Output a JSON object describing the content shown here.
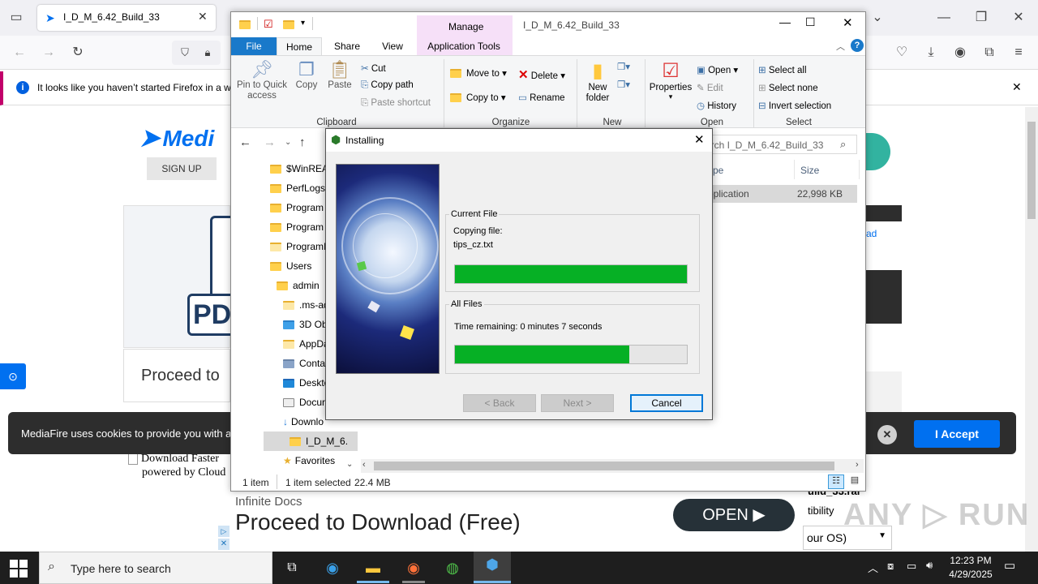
{
  "browser": {
    "tab_title": "I_D_M_6.42_Build_33",
    "notification": "It looks like you haven’t started Firefox in a wh",
    "signup": "SIGN UP",
    "logo": "Medi",
    "proceed_partial": "Proceed to",
    "download_faster": "Download Faster",
    "powered_by": "powered by Cloud",
    "cookie_text": "MediaFire uses cookies to provide you with a",
    "accept": "I Accept",
    "right_link": "ad",
    "right_file": "uild_33.rar",
    "right_compat": "tibility",
    "right_os": "our OS)",
    "ad_brand": "Infinite Docs",
    "ad_title": "Proceed to Download (Free)",
    "ad_open": "OPEN",
    "ad_doc_text": "PD",
    "watermark": "ANY RUN"
  },
  "explorer": {
    "title": "I_D_M_6.42_Build_33",
    "manage": "Manage",
    "tabs": [
      "File",
      "Home",
      "Share",
      "View",
      "Application Tools"
    ],
    "clipboard": {
      "pin": "Pin to Quick access",
      "copy": "Copy",
      "paste": "Paste",
      "cut": "Cut",
      "copy_path": "Copy path",
      "paste_shortcut": "Paste shortcut",
      "label": "Clipboard"
    },
    "organize": {
      "move_to": "Move to",
      "copy_to": "Copy to",
      "delete": "Delete",
      "rename": "Rename",
      "label": "Organize"
    },
    "new": {
      "new_folder": "New folder",
      "label": "New"
    },
    "open": {
      "properties": "Properties",
      "open": "Open",
      "edit": "Edit",
      "history": "History",
      "label": "Open"
    },
    "select": {
      "select_all": "Select all",
      "select_none": "Select none",
      "invert": "Invert selection",
      "label": "Select"
    },
    "search_placeholder": "arch I_D_M_6.42_Build_33",
    "columns": {
      "type": "ype",
      "size": "Size"
    },
    "file_row": {
      "type": "pplication",
      "size": "22,998 KB"
    },
    "tree": [
      "$WinREA",
      "PerfLogs",
      "Program",
      "Program",
      "ProgramI",
      "Users",
      "admin",
      ".ms-ad",
      "3D Ob",
      "AppDa",
      "Conta",
      "Deskto",
      "Docur",
      "Downlo",
      "I_D_M_6.",
      "Favorites"
    ],
    "status": {
      "count": "1 item",
      "selected": "1 item selected",
      "size": "22.4 MB"
    }
  },
  "installer": {
    "title": "Installing",
    "current_file_label": "Current File",
    "copying": "Copying file:",
    "filename": "tips_cz.txt",
    "current_progress": 1.0,
    "all_files_label": "All Files",
    "time_remaining": "Time remaining: 0 minutes 7 seconds",
    "all_progress": 0.75,
    "back": "< Back",
    "next": "Next >",
    "cancel": "Cancel"
  },
  "taskbar": {
    "search_placeholder": "Type here to search",
    "time": "12:23 PM",
    "date": "4/29/2025"
  },
  "colors": {
    "progress": "#06b025",
    "accent": "#0070f0",
    "file_tab": "#1979ca",
    "manage_tab": "#f6e0f8"
  }
}
